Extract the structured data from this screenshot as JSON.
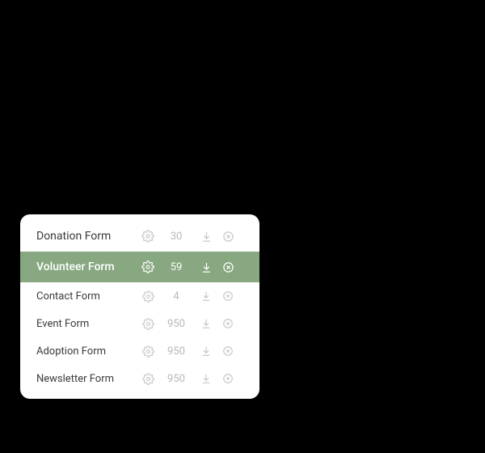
{
  "forms": [
    {
      "name": "Donation Form",
      "count": "30",
      "selected": false,
      "compact": false
    },
    {
      "name": "Volunteer Form",
      "count": "59",
      "selected": true,
      "compact": false
    },
    {
      "name": "Contact Form",
      "count": "4",
      "selected": false,
      "compact": true
    },
    {
      "name": "Event Form",
      "count": "950",
      "selected": false,
      "compact": true
    },
    {
      "name": "Adoption Form",
      "count": "950",
      "selected": false,
      "compact": true
    },
    {
      "name": "Newsletter Form",
      "count": "950",
      "selected": false,
      "compact": true
    }
  ],
  "colors": {
    "selected_bg": "#87a881",
    "muted_icon": "#c7c7c7"
  }
}
